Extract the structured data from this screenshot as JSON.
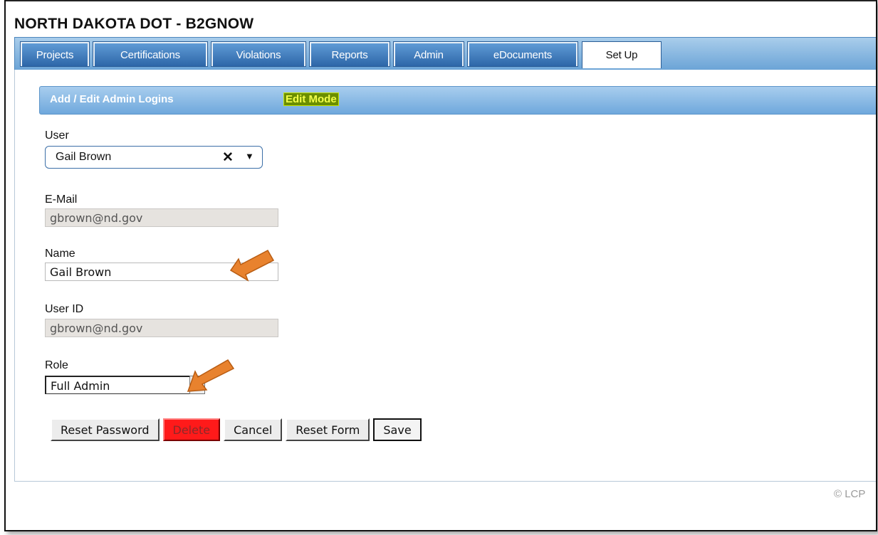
{
  "app": {
    "title": "NORTH DAKOTA DOT - B2GNOW"
  },
  "tabs": [
    {
      "label": "Projects",
      "active": false
    },
    {
      "label": "Certifications",
      "active": false
    },
    {
      "label": "Violations",
      "active": false
    },
    {
      "label": "Reports",
      "active": false
    },
    {
      "label": "Admin",
      "active": false
    },
    {
      "label": "eDocuments",
      "active": false
    },
    {
      "label": "Set Up",
      "active": true
    }
  ],
  "section": {
    "title": "Add / Edit Admin Logins",
    "mode_badge": "Edit Mode"
  },
  "form": {
    "user": {
      "label": "User",
      "value": "Gail Brown"
    },
    "email": {
      "label": "E-Mail",
      "value": "gbrown@nd.gov"
    },
    "name": {
      "label": "Name",
      "value": "Gail Brown"
    },
    "user_id": {
      "label": "User ID",
      "value": "gbrown@nd.gov"
    },
    "role": {
      "label": "Role",
      "value": "Full Admin"
    }
  },
  "buttons": {
    "reset_password": "Reset Password",
    "delete": "Delete",
    "cancel": "Cancel",
    "reset_form": "Reset Form",
    "save": "Save"
  },
  "footer": {
    "copyright": "© LCP"
  },
  "colors": {
    "tab_blue": "#2d66a8",
    "header_blue": "#6fa8dc",
    "edit_mode_bg": "#6b8e00",
    "edit_mode_text": "#f3ff4a",
    "delete_red": "#ff1a1a",
    "arrow_orange": "#e8822e"
  },
  "icons": [
    "clear-x-icon",
    "dropdown-caret-icon",
    "annotation-arrow-icon"
  ]
}
